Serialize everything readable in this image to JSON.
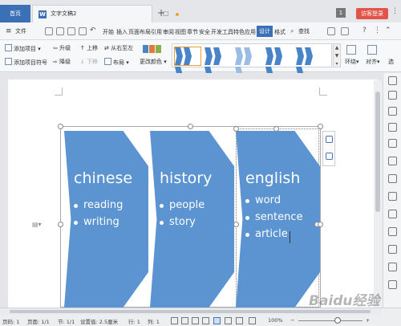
{
  "titlebar": {
    "home_tab": "首页",
    "doc_tab": "文字文稿2",
    "doc_icon": "W",
    "new_tab": "+",
    "notification_count": "1",
    "login_button": "访客登录",
    "minimize": "—",
    "maximize": "□",
    "close": "✕"
  },
  "menubar": {
    "file": "文件",
    "items": [
      "开始",
      "插入",
      "页面布局",
      "引用",
      "审阅",
      "视图",
      "章节",
      "安全",
      "开发工具",
      "特色应用",
      "设计",
      "格式"
    ],
    "active": "设计",
    "find": "查找"
  },
  "ribbon": {
    "add_item": "添加项目",
    "upgrade": "升级",
    "move_up": "上移",
    "right_to_left": "从右至左",
    "add_bullet": "添加项目符号",
    "downgrade": "降级",
    "move_down": "下移",
    "layout": "布局",
    "change_color": "更改颜色",
    "wrap": "环绕",
    "align": "对齐",
    "select": "选"
  },
  "smartart": {
    "columns": [
      {
        "title": "chinese",
        "bullets": [
          "reading",
          "writing"
        ]
      },
      {
        "title": "history",
        "bullets": [
          "people",
          "story"
        ]
      },
      {
        "title": "english",
        "bullets": [
          "word",
          "sentence",
          "article"
        ]
      }
    ],
    "fill_color": "#5b94d0"
  },
  "statusbar": {
    "page_num": "页码: 1",
    "pages": "页面: 1/1",
    "section": "节: 1/1",
    "position": "设置值: 2.5厘米",
    "row": "行: 1",
    "col": "列: 1",
    "zoom": "100%",
    "zoom_minus": "−",
    "zoom_plus": "+"
  },
  "watermark": "Baidu经验",
  "colors": {
    "accent": "#3b6fb6",
    "login": "#e25448"
  }
}
